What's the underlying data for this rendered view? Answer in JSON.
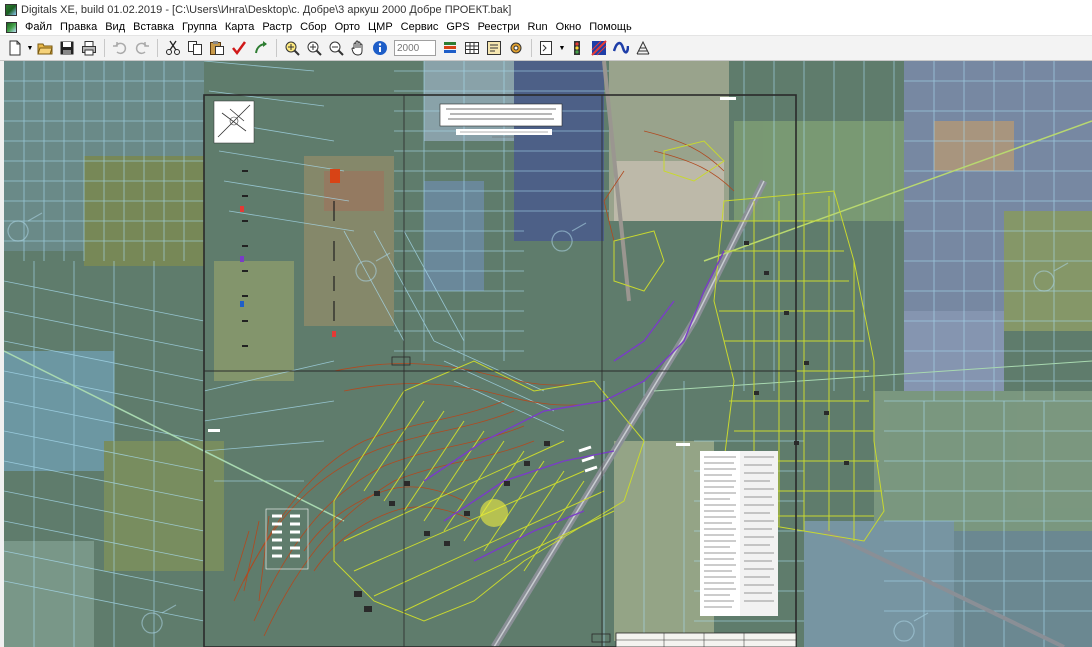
{
  "window": {
    "title": "Digitals XE, build 01.02.2019 - [C:\\Users\\Инга\\Desktop\\с. Добре\\3 аркуш 2000 Добре ПРОЕКТ.bak]"
  },
  "menu": {
    "items": [
      "Файл",
      "Правка",
      "Вид",
      "Вставка",
      "Группа",
      "Карта",
      "Растр",
      "Сбор",
      "Орто",
      "ЦМР",
      "Сервис",
      "GPS",
      "Реестри",
      "Run",
      "Окно",
      "Помощь"
    ]
  },
  "toolbar": {
    "scale_value": "2000",
    "icons": [
      "new-document-icon",
      "open-folder-icon",
      "save-icon",
      "print-icon",
      "undo-icon",
      "redo-icon",
      "cut-icon",
      "copy-icon",
      "paste-icon",
      "check-icon",
      "arrow-icon",
      "zoom-region-icon",
      "zoom-in-icon",
      "zoom-out-icon",
      "pan-hand-icon",
      "info-icon",
      "layers-icon",
      "table-icon",
      "properties-icon",
      "settings-icon",
      "raster-icon",
      "traffic-light-icon",
      "curve-icon",
      "wave-icon",
      "grid-icon"
    ]
  },
  "colors": {
    "sheet_frame": "#2a2a2a",
    "parcel_lines": "#a6d8f0",
    "settlement_lines": "#c8d830",
    "road": "#8a8f96",
    "contours": "#b04a20",
    "utilities": "#7a3cc8"
  }
}
